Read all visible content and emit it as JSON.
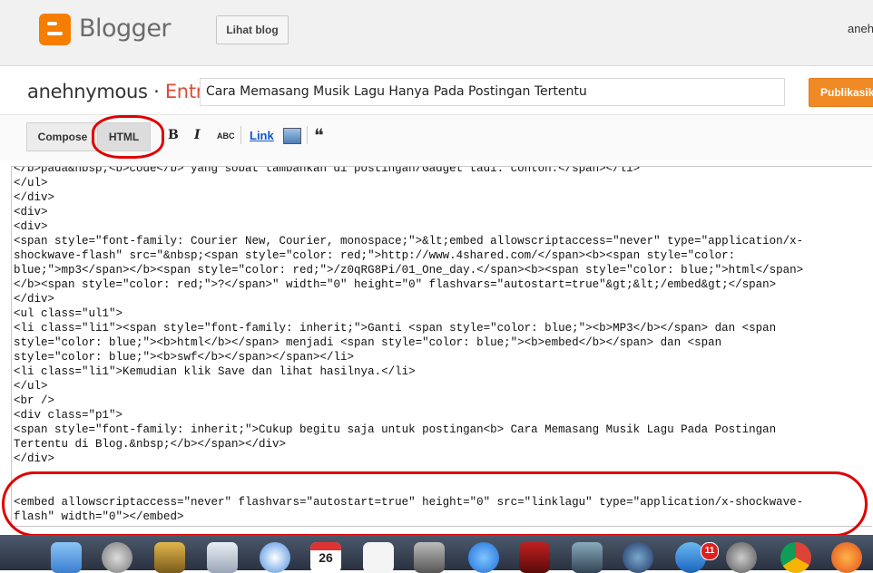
{
  "header": {
    "logo_text": "Blogger",
    "view_blog_label": "Lihat blog",
    "user_name": "aneh"
  },
  "post": {
    "blog_name": "anehnymous",
    "separator": " · ",
    "section": "Entri",
    "title_value": "Cara Memasang Musik Lagu Hanya Pada Postingan Tertentu",
    "publish_label": "Publikasik"
  },
  "toolbar": {
    "compose_label": "Compose",
    "html_label": "HTML",
    "bold_label": "B",
    "italic_label": "I",
    "spell_label": "ABC",
    "link_label": "Link",
    "quote_label": "❝"
  },
  "editor": {
    "lines": [
      "</b>pada&nbsp;<b>code</b> yang sobat tambahkan di postingan/Gadget tadi. contoh.</span></li>",
      "</ul>",
      "</div>",
      "<div>",
      "<div>",
      "<span style=\"font-family: Courier New, Courier, monospace;\">&lt;embed allowscriptaccess=\"never\" type=\"application/x-",
      "shockwave-flash\" src=\"&nbsp;<span style=\"color: red;\">http://www.4shared.com/</span><b><span style=\"color:",
      "blue;\">mp3</span></b><span style=\"color: red;\">/z0qRG8Pi/01_One_day.</span><b><span style=\"color: blue;\">html</span>",
      "</b><span style=\"color: red;\">?</span>\" width=\"0\" height=\"0\" flashvars=\"autostart=true\"&gt;&lt;/embed&gt;</span>",
      "</div>",
      "<ul class=\"ul1\">",
      "<li class=\"li1\"><span style=\"font-family: inherit;\">Ganti <span style=\"color: blue;\"><b>MP3</b></span> dan <span",
      "style=\"color: blue;\"><b>html</b></span> menjadi <span style=\"color: blue;\"><b>embed</b></span> dan <span",
      "style=\"color: blue;\"><b>swf</b></span></span></li>",
      "<li class=\"li1\">Kemudian klik Save dan lihat hasilnya.</li>",
      "</ul>",
      "<br />",
      "<div class=\"p1\">",
      "<span style=\"font-family: inherit;\">Cukup begitu saja untuk postingan<b> Cara Memasang Musik Lagu Pada Postingan",
      "Tertentu di Blog.&nbsp;</b></span></div>",
      "</div>"
    ],
    "embed_lines": [
      "<embed allowscriptaccess=\"never\" flashvars=\"autostart=true\" height=\"0\" src=\"linklagu\" type=\"application/x-shockwave-",
      "flash\" width=\"0\"></embed>"
    ]
  },
  "dock": {
    "badge_count": "11",
    "calendar_day": "26"
  },
  "colors": {
    "brand_orange": "#f57d00",
    "entri_red": "#dd4b39",
    "publish_orange": "#f08a24",
    "annotation_red": "#e00000"
  },
  "icons": [
    "blogger-logo-icon",
    "bold-icon",
    "italic-icon",
    "spellcheck-icon",
    "image-icon",
    "quote-icon"
  ]
}
